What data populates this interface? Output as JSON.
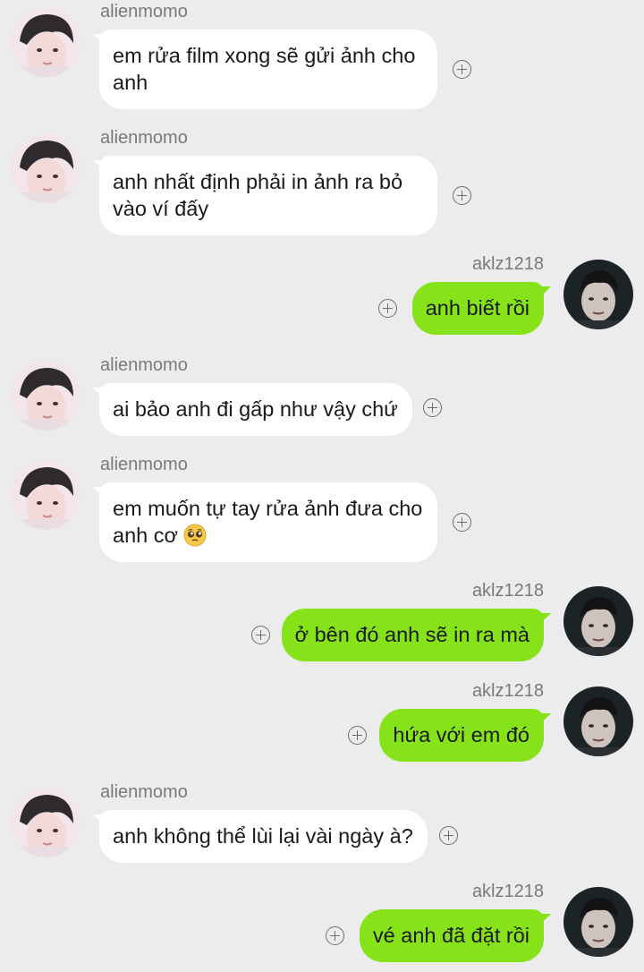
{
  "contacts": {
    "me": {
      "name": "alienmomo"
    },
    "other": {
      "name": "aklz1218"
    }
  },
  "messages": [
    {
      "from": "alienmomo",
      "text": "em rửa film xong sẽ gửi ảnh cho anh"
    },
    {
      "from": "alienmomo",
      "text": "anh nhất định phải in ảnh ra bỏ vào ví đấy"
    },
    {
      "from": "aklz1218",
      "text": "anh biết rồi"
    },
    {
      "from": "alienmomo",
      "text": "ai bảo anh đi gấp như vậy chứ"
    },
    {
      "from": "alienmomo",
      "text": "em muốn tự tay rửa ảnh đưa cho anh cơ",
      "emoji": "pleading-face-emoji"
    },
    {
      "from": "aklz1218",
      "text": "ở bên đó anh sẽ in ra mà"
    },
    {
      "from": "aklz1218",
      "text": "hứa với em đó"
    },
    {
      "from": "alienmomo",
      "text": "anh không thể lùi lại vài ngày à?"
    },
    {
      "from": "aklz1218",
      "text": "vé anh đã đặt rồi"
    }
  ],
  "colors": {
    "background": "#ececec",
    "incoming_bubble": "#ffffff",
    "outgoing_bubble": "#86e219",
    "sender_name": "#7a7a7a",
    "message_text": "#1a1a1a"
  },
  "icons": {
    "message_action": "plus-circle-icon"
  }
}
